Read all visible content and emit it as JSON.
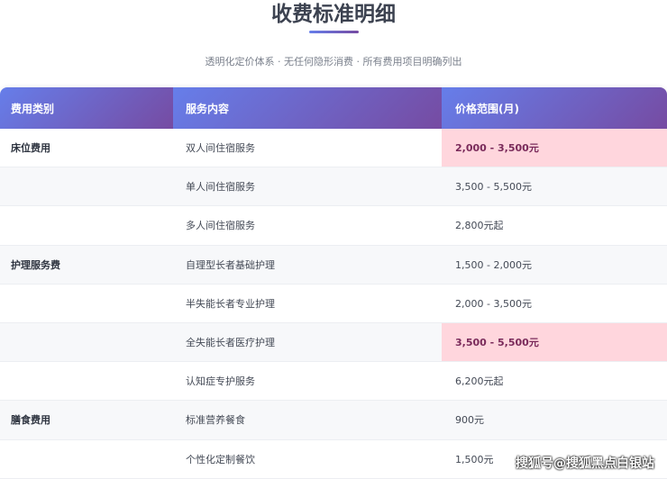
{
  "title": "收费标准明细",
  "subtitle": "透明化定价体系 · 无任何隐形消费 · 所有费用项目明确列出",
  "headers": [
    "费用类别",
    "服务内容",
    "价格范围(月)"
  ],
  "rows": [
    {
      "category": "床位费用",
      "service": "双人间住宿服务",
      "price": "2,000 - 3,500元",
      "highlight": true
    },
    {
      "category": "",
      "service": "单人间住宿服务",
      "price": "3,500 - 5,500元",
      "highlight": false
    },
    {
      "category": "",
      "service": "多人间住宿服务",
      "price": "2,800元起",
      "highlight": false
    },
    {
      "category": "护理服务费",
      "service": "自理型长者基础护理",
      "price": "1,500 - 2,000元",
      "highlight": false
    },
    {
      "category": "",
      "service": "半失能长者专业护理",
      "price": "2,000 - 3,500元",
      "highlight": false
    },
    {
      "category": "",
      "service": "全失能长者医疗护理",
      "price": "3,500 - 5,500元",
      "highlight": true
    },
    {
      "category": "",
      "service": "认知症专护服务",
      "price": "6,200元起",
      "highlight": false
    },
    {
      "category": "膳食费用",
      "service": "标准营养餐食",
      "price": "900元",
      "highlight": false
    },
    {
      "category": "",
      "service": "个性化定制餐饮",
      "price": "1,500元",
      "highlight": false
    }
  ],
  "watermark": "搜狐号@搜狐黑点白银站"
}
